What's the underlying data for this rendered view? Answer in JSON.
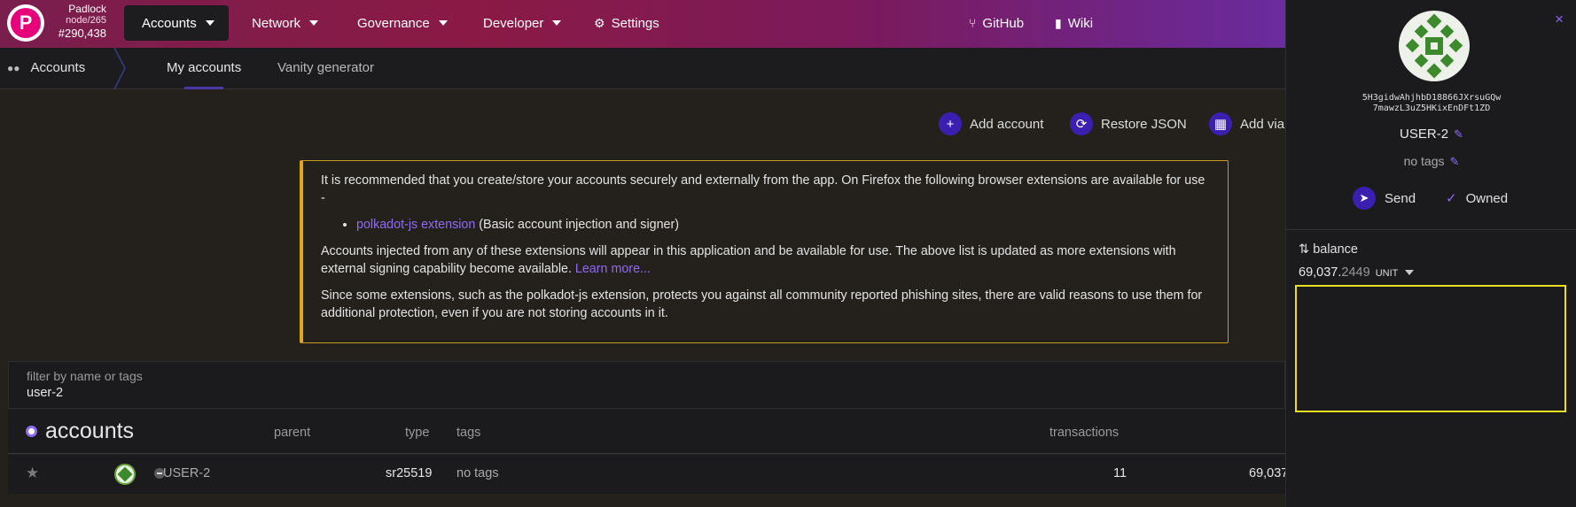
{
  "header": {
    "chain_name": "Padlock",
    "node": "node/265",
    "block": "#290,438",
    "nav": {
      "accounts": "Accounts",
      "network": "Network",
      "governance": "Governance",
      "developer": "Developer",
      "settings": "Settings",
      "github": "GitHub",
      "wiki": "Wiki"
    }
  },
  "subnav": {
    "section": "Accounts",
    "tabs": [
      "My accounts",
      "Vanity generator"
    ]
  },
  "actions": {
    "add_account": "Add account",
    "restore_json": "Restore JSON",
    "add_via": "Add via"
  },
  "info": {
    "p1": "It is recommended that you create/store your accounts securely and externally from the app. On Firefox the following browser extensions are available for use -",
    "ext_link": "polkadot-js extension",
    "ext_desc": " (Basic account injection and signer)",
    "p2": "Accounts injected from any of these extensions will appear in this application and be available for use. The above list is updated as more extensions with external signing capability become available. ",
    "learn_more": "Learn more...",
    "p3": "Since some extensions, such as the polkadot-js extension, protects you against all community reported phishing sites, there are valid reasons to use them for additional protection, even if you are not storing accounts in it."
  },
  "filter": {
    "label": "filter by name or tags",
    "value": "user-2"
  },
  "table": {
    "title": "accounts",
    "headers": {
      "parent": "parent",
      "type": "type",
      "tags": "tags",
      "transactions": "transactions"
    },
    "rows": [
      {
        "name": "USER-2",
        "type": "sr25519",
        "tags": "no tags",
        "transactions": "11",
        "balance": "69,037"
      }
    ]
  },
  "sidebar": {
    "close": "×",
    "address_line1": "5H3gidwAhjhbD18866JXrsuGQw",
    "address_line2": "7mawzL3uZ5HKixEnDFt1ZD",
    "name": "USER-2",
    "tags": "no tags",
    "send": "Send",
    "owned": "Owned",
    "balance_label": "balance",
    "balance_int": "69,037.",
    "balance_dec": "2449",
    "balance_unit": "UNIT"
  }
}
